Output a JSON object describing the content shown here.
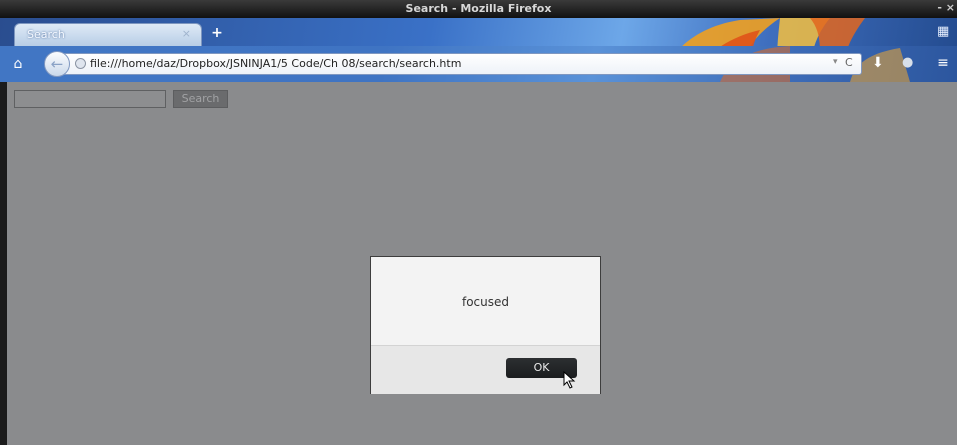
{
  "window": {
    "title": "Search - Mozilla Firefox",
    "controls": "- ×"
  },
  "tabs": [
    {
      "label": "Search",
      "close": "×"
    }
  ],
  "toolbar": {
    "new_tab": "+",
    "home_icon": "home-icon",
    "back_icon": "back-arrow-icon",
    "url": "file:///home/daz/Dropbox/JSNINJA1/5 Code/Ch 08/search/search.htm",
    "url_dropdown": "▾",
    "reload": "C",
    "download_icon": "download-icon",
    "menu_icon": "menu-icon"
  },
  "page": {
    "search_input_value": "",
    "search_button_label": "Search"
  },
  "dialog": {
    "message": "focused",
    "ok_label": "OK"
  },
  "colors": {
    "page_overlay": "#8a8b8d",
    "dialog_bg": "#f3f3f3",
    "ok_button": "#1f2123"
  }
}
